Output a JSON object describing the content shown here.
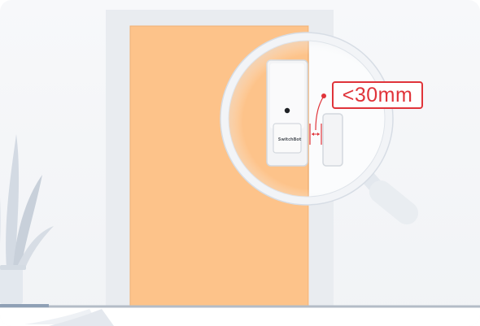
{
  "measurement": {
    "label": "<30mm",
    "accent_color": "#e0343a"
  },
  "device": {
    "brand_text": "SwitchBot"
  },
  "colors": {
    "door": "#fdc38a",
    "door_frame": "#e9ecf0",
    "wall": "#f3f5f8",
    "floor_line": "#b4bcc7",
    "plant": "#cfd6df"
  },
  "icons": {
    "magnifier": "magnifying-glass-icon",
    "plant": "plant-icon"
  }
}
